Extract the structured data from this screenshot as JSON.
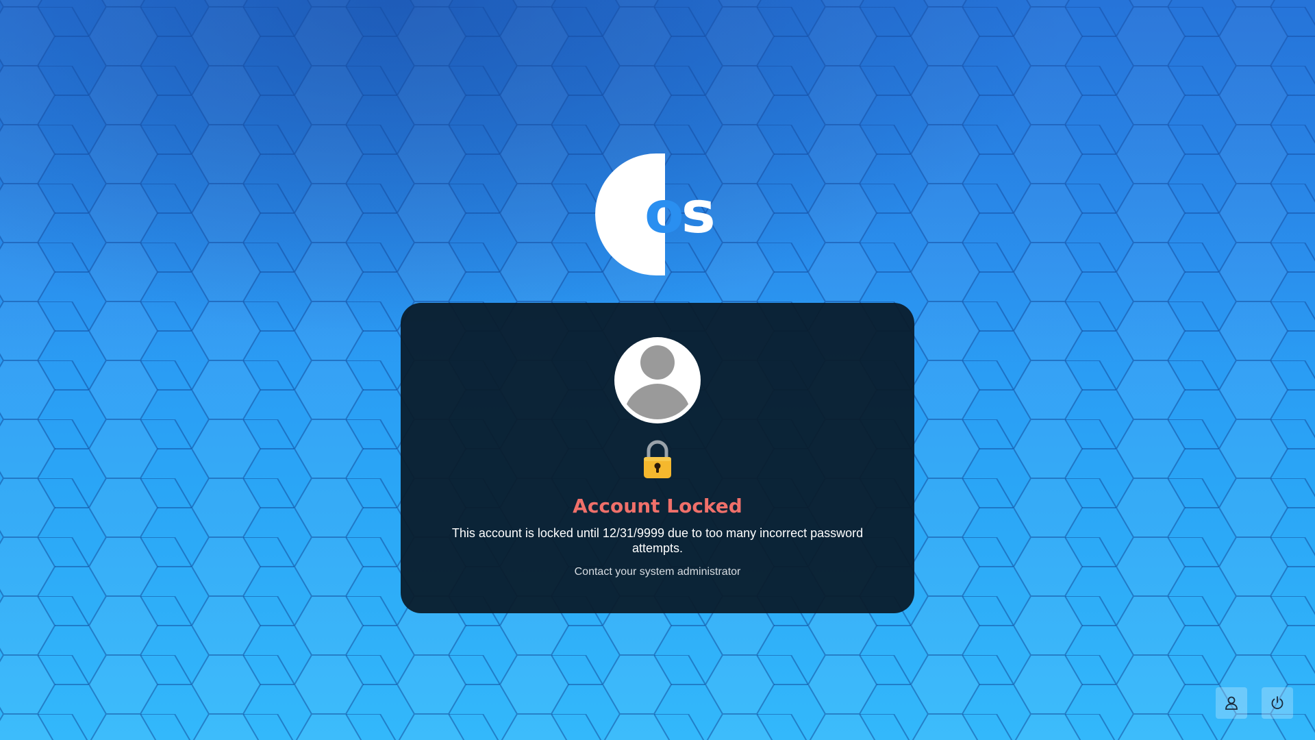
{
  "logo": {
    "text": "os"
  },
  "lock_screen": {
    "avatar_icon": "user-avatar-icon",
    "lock_icon": "padlock-icon",
    "title": "Account Locked",
    "message": "This account is locked until 12/31/9999 due to too many incorrect password attempts.",
    "contact": "Contact your system administrator",
    "title_color": "#f0706a"
  },
  "corner_buttons": {
    "switch_user_icon": "user-icon",
    "power_icon": "power-icon"
  },
  "colors": {
    "wallpaper": "#2a94f2",
    "card_background": "#0a1c2a"
  }
}
